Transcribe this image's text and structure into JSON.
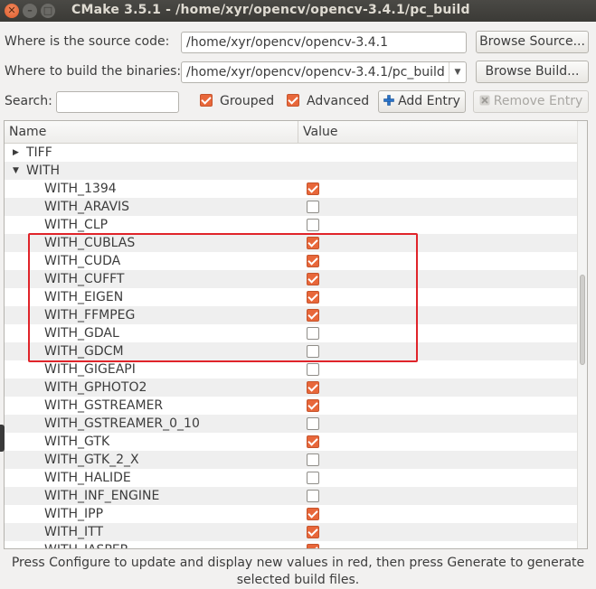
{
  "window": {
    "title": "CMake 3.5.1 - /home/xyr/opencv/opencv-3.4.1/pc_build",
    "close_glyph": "✕",
    "min_glyph": "–",
    "max_glyph": "□"
  },
  "source": {
    "label": "Where is the source code:",
    "value": "/home/xyr/opencv/opencv-3.4.1",
    "browse_label": "Browse Source..."
  },
  "build": {
    "label": "Where to build the binaries:",
    "value": "/home/xyr/opencv/opencv-3.4.1/pc_build",
    "browse_label": "Browse Build..."
  },
  "search": {
    "label": "Search:",
    "value": ""
  },
  "options": {
    "grouped": {
      "label": "Grouped",
      "checked": true
    },
    "advanced": {
      "label": "Advanced",
      "checked": true
    }
  },
  "actions": {
    "add_entry": "Add Entry",
    "add_icon": "plus-icon",
    "remove_entry": "Remove Entry",
    "remove_icon": "remove-icon"
  },
  "table": {
    "columns": {
      "name": "Name",
      "value": "Value"
    },
    "groups": [
      {
        "name": "TIFF",
        "expanded": false
      },
      {
        "name": "WITH",
        "expanded": true
      }
    ],
    "entries": [
      {
        "name": "WITH_1394",
        "checked": true
      },
      {
        "name": "WITH_ARAVIS",
        "checked": false
      },
      {
        "name": "WITH_CLP",
        "checked": false
      },
      {
        "name": "WITH_CUBLAS",
        "checked": true
      },
      {
        "name": "WITH_CUDA",
        "checked": true
      },
      {
        "name": "WITH_CUFFT",
        "checked": true
      },
      {
        "name": "WITH_EIGEN",
        "checked": true
      },
      {
        "name": "WITH_FFMPEG",
        "checked": true
      },
      {
        "name": "WITH_GDAL",
        "checked": false
      },
      {
        "name": "WITH_GDCM",
        "checked": false
      },
      {
        "name": "WITH_GIGEAPI",
        "checked": false
      },
      {
        "name": "WITH_GPHOTO2",
        "checked": true
      },
      {
        "name": "WITH_GSTREAMER",
        "checked": true
      },
      {
        "name": "WITH_GSTREAMER_0_10",
        "checked": false
      },
      {
        "name": "WITH_GTK",
        "checked": true
      },
      {
        "name": "WITH_GTK_2_X",
        "checked": false
      },
      {
        "name": "WITH_HALIDE",
        "checked": false
      },
      {
        "name": "WITH_INF_ENGINE",
        "checked": false
      },
      {
        "name": "WITH_IPP",
        "checked": true
      },
      {
        "name": "WITH_ITT",
        "checked": true
      },
      {
        "name": "WITH_JASPER",
        "checked": true
      }
    ]
  },
  "footer": {
    "line1": "Press Configure to update and display new values in red, then press Generate to generate",
    "line2": "selected build files."
  },
  "colors": {
    "checkbox_accent": "#e8673a",
    "highlight_box": "#e0242a",
    "titlebar": "#3b3a36"
  }
}
